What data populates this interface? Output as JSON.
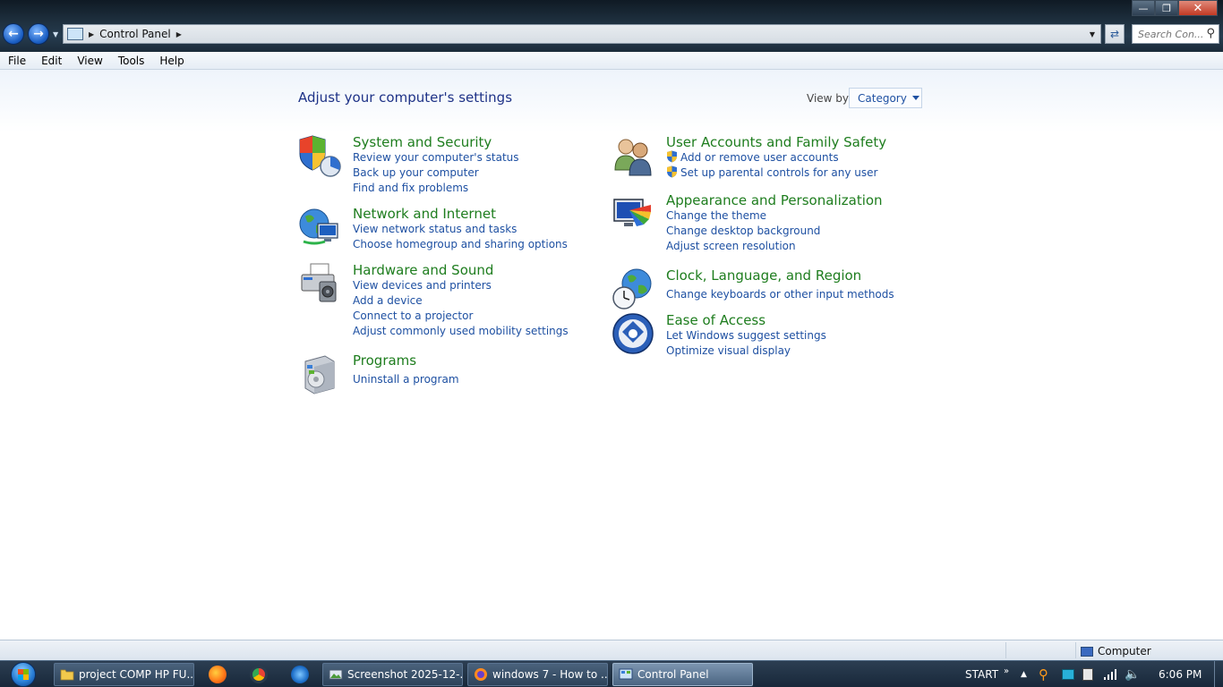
{
  "window": {
    "breadcrumb": "Control Panel",
    "search_placeholder": "Search Con..."
  },
  "menu": [
    "File",
    "Edit",
    "View",
    "Tools",
    "Help"
  ],
  "page": {
    "title": "Adjust your computer's settings",
    "view_by_label": "View by:",
    "view_by_value": "Category"
  },
  "categories_left": [
    {
      "title": "System and Security",
      "icon": "shield-chart-icon",
      "links": [
        "Review your computer's status",
        "Back up your computer",
        "Find and fix problems"
      ]
    },
    {
      "title": "Network and Internet",
      "icon": "globe-network-icon",
      "links": [
        "View network status and tasks",
        "Choose homegroup and sharing options"
      ]
    },
    {
      "title": "Hardware and Sound",
      "icon": "printer-speaker-icon",
      "links": [
        "View devices and printers",
        "Add a device",
        "Connect to a projector",
        "Adjust commonly used mobility settings"
      ]
    },
    {
      "title": "Programs",
      "icon": "programs-box-icon",
      "links": [
        "Uninstall a program"
      ]
    }
  ],
  "categories_right": [
    {
      "title": "User Accounts and Family Safety",
      "icon": "users-icon",
      "links": [
        "Add or remove user accounts",
        "Set up parental controls for any user"
      ]
    },
    {
      "title": "Appearance and Personalization",
      "icon": "monitor-palette-icon",
      "links": [
        "Change the theme",
        "Change desktop background",
        "Adjust screen resolution"
      ]
    },
    {
      "title": "Clock, Language, and Region",
      "icon": "globe-clock-icon",
      "links": [
        "Change keyboards or other input methods"
      ]
    },
    {
      "title": "Ease of Access",
      "icon": "ease-of-access-icon",
      "links": [
        "Let Windows suggest settings",
        "Optimize visual display"
      ]
    }
  ],
  "status_bar": {
    "location": "Computer"
  },
  "taskbar": {
    "items": [
      {
        "label": "project COMP HP FU...",
        "icon": "folder-icon"
      },
      {
        "label": "Screenshot 2025-12-...",
        "icon": "image-viewer-icon"
      },
      {
        "label": "windows 7 - How to ...",
        "icon": "firefox-icon"
      },
      {
        "label": "Control Panel",
        "icon": "control-panel-icon"
      }
    ],
    "start_label": "START",
    "clock": "6:06 PM"
  }
}
